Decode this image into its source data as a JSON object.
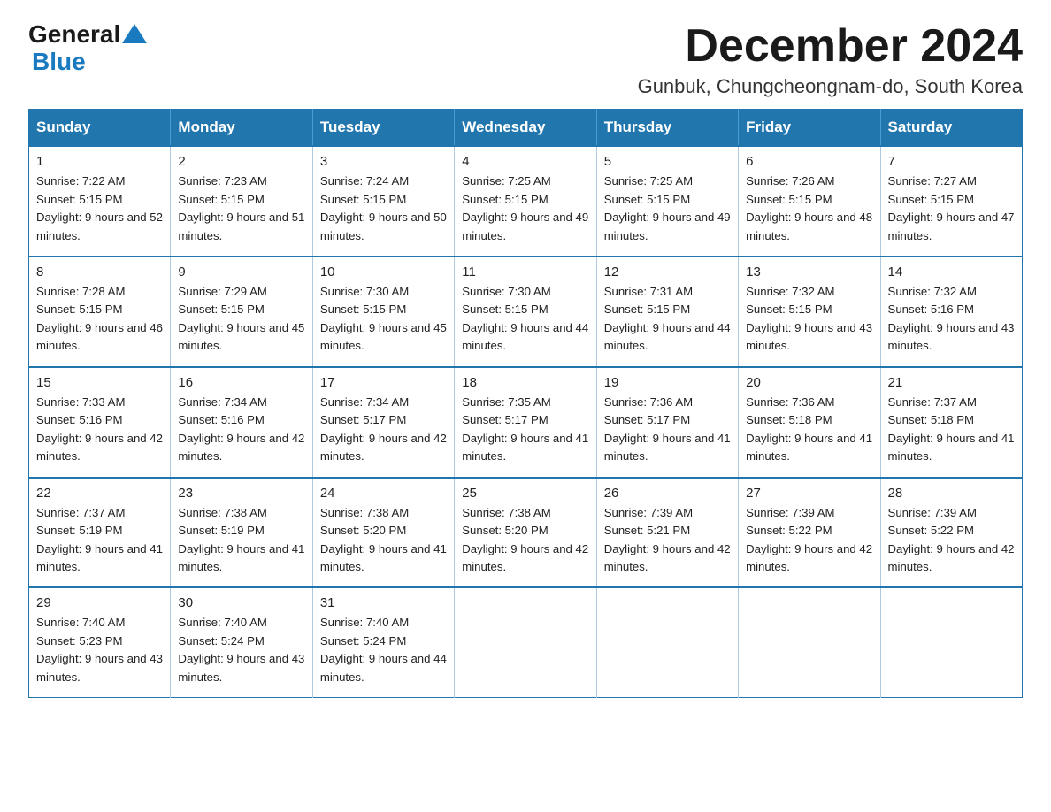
{
  "header": {
    "logo_general": "General",
    "logo_blue": "Blue",
    "month_title": "December 2024",
    "location": "Gunbuk, Chungcheongnam-do, South Korea"
  },
  "weekdays": [
    "Sunday",
    "Monday",
    "Tuesday",
    "Wednesday",
    "Thursday",
    "Friday",
    "Saturday"
  ],
  "weeks": [
    [
      {
        "day": 1,
        "sunrise": "7:22 AM",
        "sunset": "5:15 PM",
        "daylight": "9 hours and 52 minutes."
      },
      {
        "day": 2,
        "sunrise": "7:23 AM",
        "sunset": "5:15 PM",
        "daylight": "9 hours and 51 minutes."
      },
      {
        "day": 3,
        "sunrise": "7:24 AM",
        "sunset": "5:15 PM",
        "daylight": "9 hours and 50 minutes."
      },
      {
        "day": 4,
        "sunrise": "7:25 AM",
        "sunset": "5:15 PM",
        "daylight": "9 hours and 49 minutes."
      },
      {
        "day": 5,
        "sunrise": "7:25 AM",
        "sunset": "5:15 PM",
        "daylight": "9 hours and 49 minutes."
      },
      {
        "day": 6,
        "sunrise": "7:26 AM",
        "sunset": "5:15 PM",
        "daylight": "9 hours and 48 minutes."
      },
      {
        "day": 7,
        "sunrise": "7:27 AM",
        "sunset": "5:15 PM",
        "daylight": "9 hours and 47 minutes."
      }
    ],
    [
      {
        "day": 8,
        "sunrise": "7:28 AM",
        "sunset": "5:15 PM",
        "daylight": "9 hours and 46 minutes."
      },
      {
        "day": 9,
        "sunrise": "7:29 AM",
        "sunset": "5:15 PM",
        "daylight": "9 hours and 45 minutes."
      },
      {
        "day": 10,
        "sunrise": "7:30 AM",
        "sunset": "5:15 PM",
        "daylight": "9 hours and 45 minutes."
      },
      {
        "day": 11,
        "sunrise": "7:30 AM",
        "sunset": "5:15 PM",
        "daylight": "9 hours and 44 minutes."
      },
      {
        "day": 12,
        "sunrise": "7:31 AM",
        "sunset": "5:15 PM",
        "daylight": "9 hours and 44 minutes."
      },
      {
        "day": 13,
        "sunrise": "7:32 AM",
        "sunset": "5:15 PM",
        "daylight": "9 hours and 43 minutes."
      },
      {
        "day": 14,
        "sunrise": "7:32 AM",
        "sunset": "5:16 PM",
        "daylight": "9 hours and 43 minutes."
      }
    ],
    [
      {
        "day": 15,
        "sunrise": "7:33 AM",
        "sunset": "5:16 PM",
        "daylight": "9 hours and 42 minutes."
      },
      {
        "day": 16,
        "sunrise": "7:34 AM",
        "sunset": "5:16 PM",
        "daylight": "9 hours and 42 minutes."
      },
      {
        "day": 17,
        "sunrise": "7:34 AM",
        "sunset": "5:17 PM",
        "daylight": "9 hours and 42 minutes."
      },
      {
        "day": 18,
        "sunrise": "7:35 AM",
        "sunset": "5:17 PM",
        "daylight": "9 hours and 41 minutes."
      },
      {
        "day": 19,
        "sunrise": "7:36 AM",
        "sunset": "5:17 PM",
        "daylight": "9 hours and 41 minutes."
      },
      {
        "day": 20,
        "sunrise": "7:36 AM",
        "sunset": "5:18 PM",
        "daylight": "9 hours and 41 minutes."
      },
      {
        "day": 21,
        "sunrise": "7:37 AM",
        "sunset": "5:18 PM",
        "daylight": "9 hours and 41 minutes."
      }
    ],
    [
      {
        "day": 22,
        "sunrise": "7:37 AM",
        "sunset": "5:19 PM",
        "daylight": "9 hours and 41 minutes."
      },
      {
        "day": 23,
        "sunrise": "7:38 AM",
        "sunset": "5:19 PM",
        "daylight": "9 hours and 41 minutes."
      },
      {
        "day": 24,
        "sunrise": "7:38 AM",
        "sunset": "5:20 PM",
        "daylight": "9 hours and 41 minutes."
      },
      {
        "day": 25,
        "sunrise": "7:38 AM",
        "sunset": "5:20 PM",
        "daylight": "9 hours and 42 minutes."
      },
      {
        "day": 26,
        "sunrise": "7:39 AM",
        "sunset": "5:21 PM",
        "daylight": "9 hours and 42 minutes."
      },
      {
        "day": 27,
        "sunrise": "7:39 AM",
        "sunset": "5:22 PM",
        "daylight": "9 hours and 42 minutes."
      },
      {
        "day": 28,
        "sunrise": "7:39 AM",
        "sunset": "5:22 PM",
        "daylight": "9 hours and 42 minutes."
      }
    ],
    [
      {
        "day": 29,
        "sunrise": "7:40 AM",
        "sunset": "5:23 PM",
        "daylight": "9 hours and 43 minutes."
      },
      {
        "day": 30,
        "sunrise": "7:40 AM",
        "sunset": "5:24 PM",
        "daylight": "9 hours and 43 minutes."
      },
      {
        "day": 31,
        "sunrise": "7:40 AM",
        "sunset": "5:24 PM",
        "daylight": "9 hours and 44 minutes."
      },
      null,
      null,
      null,
      null
    ]
  ]
}
